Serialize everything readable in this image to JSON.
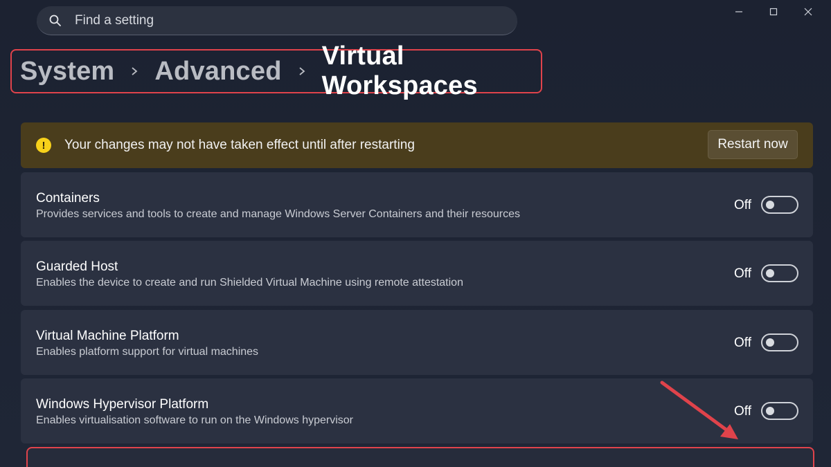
{
  "window": {
    "controls": [
      "minimize-icon",
      "maximize-icon",
      "close-icon"
    ]
  },
  "search": {
    "placeholder": "Find a setting"
  },
  "breadcrumb": {
    "items": [
      "System",
      "Advanced",
      "Virtual Workspaces"
    ]
  },
  "banner": {
    "icon": "warning-icon",
    "text": "Your changes may not have taken effect until after restarting",
    "button_label": "Restart now",
    "color": "#4a3d1c"
  },
  "settings": [
    {
      "title": "Containers",
      "description": "Provides services and tools to create and manage Windows Server Containers and their resources",
      "state": "Off",
      "enabled": false
    },
    {
      "title": "Guarded Host",
      "description": "Enables the device to create and run Shielded Virtual Machine using remote attestation",
      "state": "Off",
      "enabled": false
    },
    {
      "title": "Virtual Machine Platform",
      "description": "Enables platform support for virtual machines",
      "state": "Off",
      "enabled": false
    },
    {
      "title": "Windows Hypervisor Platform",
      "description": "Enables virtualisation software to run on the Windows hypervisor",
      "state": "Off",
      "enabled": false
    }
  ],
  "annotation": {
    "highlight_color": "#e0434b"
  }
}
